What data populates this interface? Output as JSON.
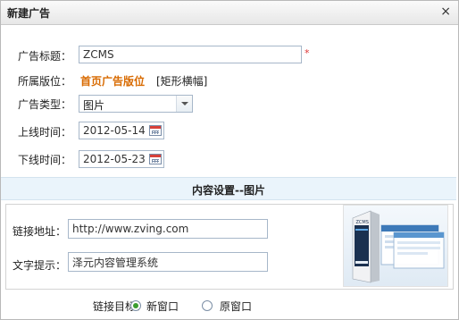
{
  "dialog": {
    "title": "新建广告",
    "close_glyph": "×"
  },
  "form": {
    "ad_title": {
      "label": "广告标题：",
      "value": "ZCMS",
      "required_mark": "*"
    },
    "ad_slot": {
      "label": "所属版位：",
      "slot_name": "首页广告版位",
      "slot_type": "[矩形横幅]"
    },
    "ad_type": {
      "label": "广告类型：",
      "selected": "图片"
    },
    "start_date": {
      "label": "上线时间：",
      "value": "2012-05-14"
    },
    "end_date": {
      "label": "下线时间：",
      "value": "2012-05-23"
    }
  },
  "content_section": {
    "title": "内容设置--图片",
    "link": {
      "label": "链接地址：",
      "value": "http://www.zving.com"
    },
    "alt_text": {
      "label": "文字提示：",
      "value": "泽元内容管理系统"
    },
    "preview_label": "ZCMS"
  },
  "link_target": {
    "label": "链接目标：",
    "options": [
      {
        "label": "新窗口",
        "checked": true
      },
      {
        "label": "原窗口",
        "checked": false
      }
    ]
  }
}
